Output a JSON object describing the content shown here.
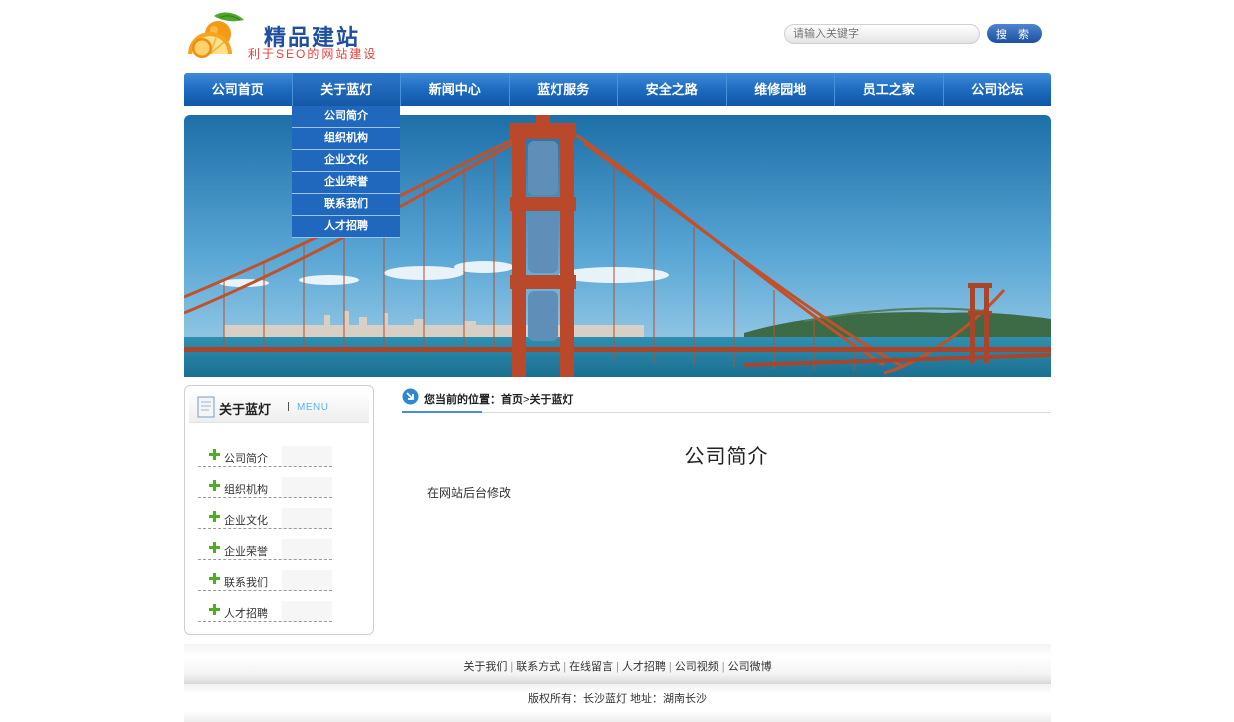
{
  "header": {
    "logo_title": "精品建站",
    "logo_subtitle": "利于SEO的网站建设",
    "search": {
      "placeholder": "请输入关键字",
      "button_label": "搜 索"
    }
  },
  "nav": {
    "items": [
      {
        "label": "公司首页"
      },
      {
        "label": "关于蓝灯"
      },
      {
        "label": "新闻中心"
      },
      {
        "label": "蓝灯服务"
      },
      {
        "label": "安全之路"
      },
      {
        "label": "维修园地"
      },
      {
        "label": "员工之家"
      },
      {
        "label": "公司论坛"
      }
    ],
    "active_index": 1,
    "dropdown": [
      "公司简介",
      "组织机构",
      "企业文化",
      "企业荣誉",
      "联系我们",
      "人才招聘"
    ]
  },
  "sidebar": {
    "title": "关于蓝灯",
    "subtitle": "MENU",
    "items": [
      "公司简介",
      "组织机构",
      "企业文化",
      "企业荣誉",
      "联系我们",
      "人才招聘"
    ]
  },
  "breadcrumb": {
    "prefix": "您当前的位置：",
    "home": "首页",
    "separator": ">",
    "current": "关于蓝灯"
  },
  "content": {
    "title": "公司简介",
    "body": "在网站后台修改"
  },
  "footer": {
    "links": [
      "关于我们",
      "联系方式",
      "在线留言",
      "人才招聘",
      "公司视频",
      "公司微博"
    ],
    "copyright": "版权所有：长沙蓝灯 地址：湖南长沙"
  },
  "colors": {
    "nav_blue": "#1e6bc0",
    "dropdown_blue": "#1f68bd",
    "logo_blue": "#1f4f9e",
    "logo_red": "#e8403a",
    "accent_light_blue": "#58b6e6",
    "plus_green": "#4caf1f"
  },
  "icons": {
    "logo": "orange-fruit-icon",
    "sidebar_title": "document-icon",
    "sidebar_items": "plus-icon",
    "breadcrumb": "arrow-circle-icon"
  }
}
